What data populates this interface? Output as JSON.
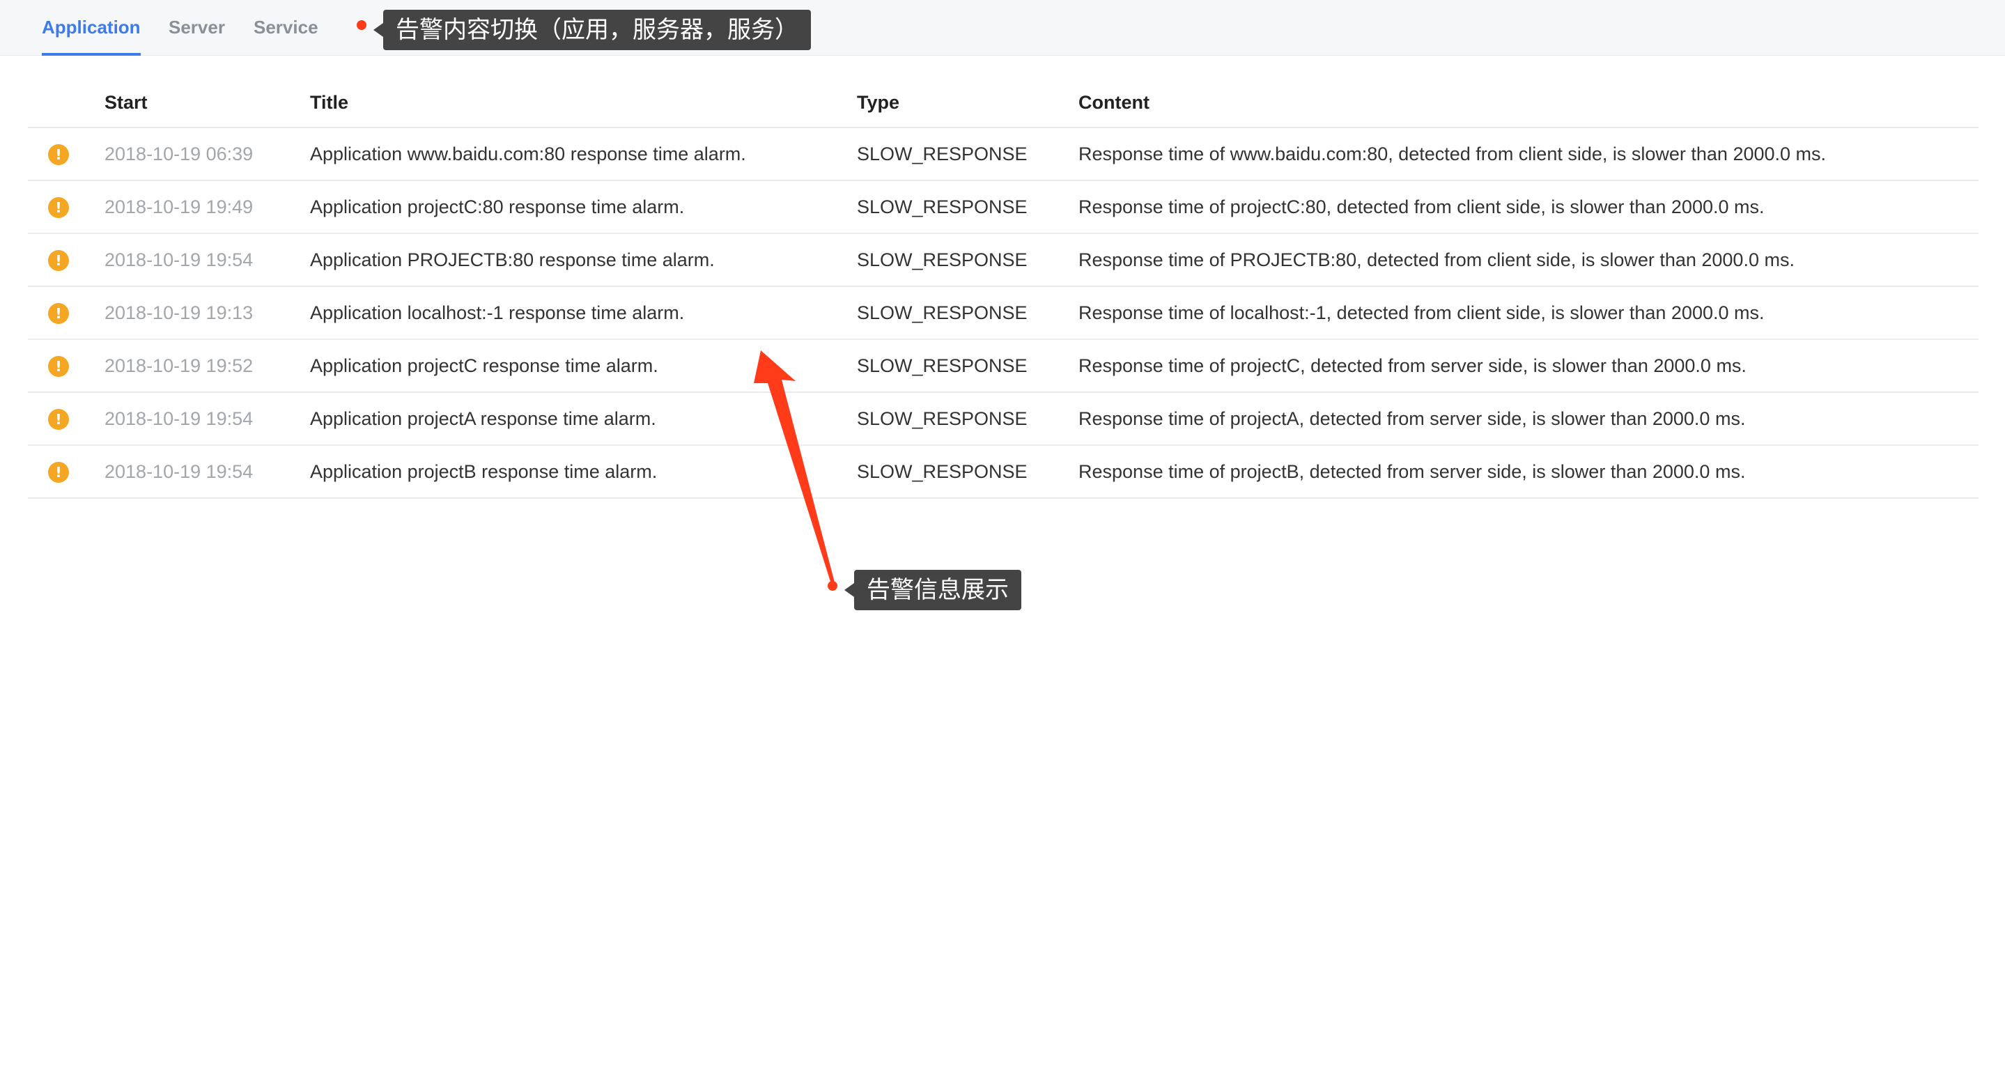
{
  "tabs": [
    {
      "label": "Application",
      "active": true
    },
    {
      "label": "Server",
      "active": false
    },
    {
      "label": "Service",
      "active": false
    }
  ],
  "annotations": {
    "tabs_note": "告警内容切换（应用，服务器，服务）",
    "alarms_note": "告警信息展示",
    "color": "#ff3b1a"
  },
  "table": {
    "columns": [
      "Start",
      "Title",
      "Type",
      "Content"
    ],
    "rows": [
      {
        "icon": "warning-icon",
        "start": "2018-10-19 06:39",
        "title": "Application www.baidu.com:80 response time alarm.",
        "type": "SLOW_RESPONSE",
        "content": "Response time of www.baidu.com:80, detected from client side, is slower than 2000.0 ms."
      },
      {
        "icon": "warning-icon",
        "start": "2018-10-19 19:49",
        "title": "Application projectC:80 response time alarm.",
        "type": "SLOW_RESPONSE",
        "content": "Response time of projectC:80, detected from client side, is slower than 2000.0 ms."
      },
      {
        "icon": "warning-icon",
        "start": "2018-10-19 19:54",
        "title": "Application PROJECTB:80 response time alarm.",
        "type": "SLOW_RESPONSE",
        "content": "Response time of PROJECTB:80, detected from client side, is slower than 2000.0 ms."
      },
      {
        "icon": "warning-icon",
        "start": "2018-10-19 19:13",
        "title": "Application localhost:-1 response time alarm.",
        "type": "SLOW_RESPONSE",
        "content": "Response time of localhost:-1, detected from client side, is slower than 2000.0 ms."
      },
      {
        "icon": "warning-icon",
        "start": "2018-10-19 19:52",
        "title": "Application projectC response time alarm.",
        "type": "SLOW_RESPONSE",
        "content": "Response time of projectC, detected from server side, is slower than 2000.0 ms."
      },
      {
        "icon": "warning-icon",
        "start": "2018-10-19 19:54",
        "title": "Application projectA response time alarm.",
        "type": "SLOW_RESPONSE",
        "content": "Response time of projectA, detected from server side, is slower than 2000.0 ms."
      },
      {
        "icon": "warning-icon",
        "start": "2018-10-19 19:54",
        "title": "Application projectB response time alarm.",
        "type": "SLOW_RESPONSE",
        "content": "Response time of projectB, detected from server side, is slower than 2000.0 ms."
      }
    ]
  },
  "colors": {
    "accent": "#3d7be8",
    "warning": "#f5a623",
    "muted_text": "#a3a6ab"
  }
}
